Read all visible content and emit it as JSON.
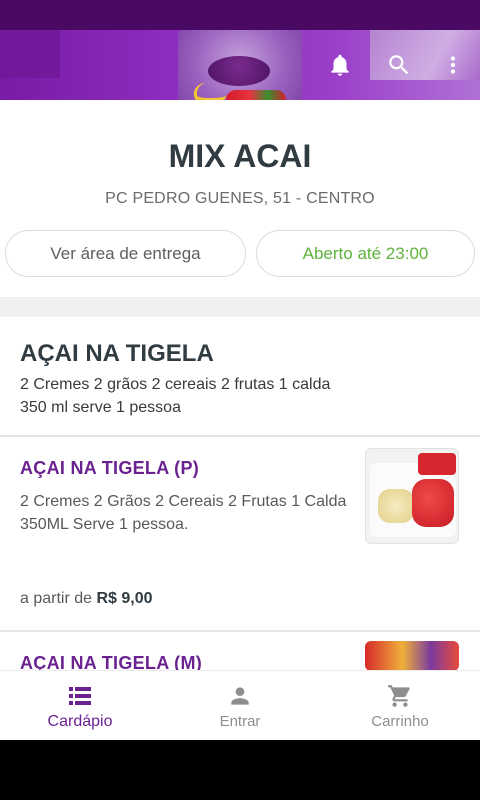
{
  "store": {
    "name": "MIX ACAI",
    "address": "PC PEDRO GUENES, 51 - CENTRO",
    "delivery_button": "Ver área de entrega",
    "open_status": "Aberto até 23:00"
  },
  "header": {
    "icons": [
      "bell-icon",
      "search-icon",
      "more-vert-icon"
    ]
  },
  "category": {
    "title": "AÇAI NA TIGELA",
    "description": "2 Cremes 2 grãos 2 cereais 2 frutas 1 calda\n350 ml serve 1 pessoa"
  },
  "items": [
    {
      "name": "AÇAI NA TIGELA (P)",
      "description": "2 Cremes 2 Grãos  2 Cereais 2 Frutas 1 Calda\n350ML Serve 1 pessoa.",
      "price_prefix": "a partir de",
      "price": "R$ 9,00"
    },
    {
      "name": "AÇAI NA TIGELA (M)"
    }
  ],
  "nav": [
    {
      "label": "Cardápio",
      "icon": "menu-list-icon",
      "active": true
    },
    {
      "label": "Entrar",
      "icon": "person-icon",
      "active": false
    },
    {
      "label": "Carrinho",
      "icon": "cart-icon",
      "active": false
    }
  ],
  "colors": {
    "brand_purple": "#6b2291",
    "open_green": "#5eb43a",
    "header_purple": "#8d2cbf"
  }
}
